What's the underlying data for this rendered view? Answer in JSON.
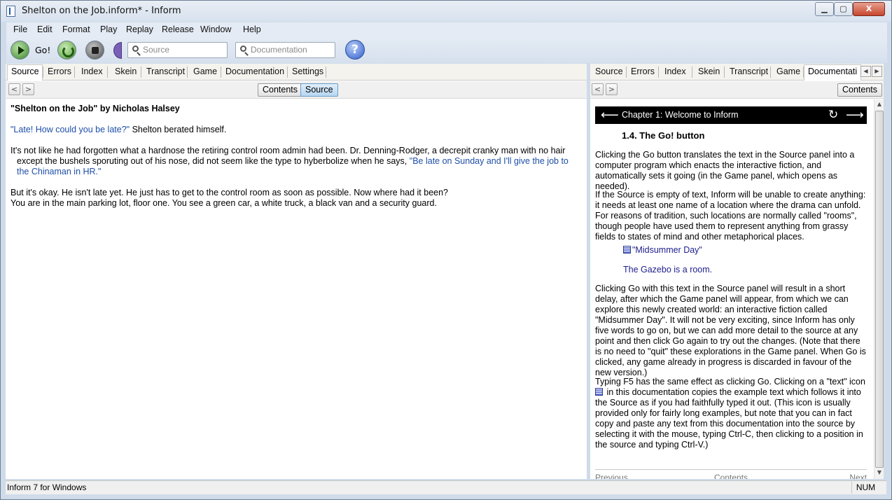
{
  "window": {
    "title": "Shelton on the Job.inform* - Inform",
    "min_label": "▁",
    "max_label": "▢",
    "close_label": "X"
  },
  "menu": {
    "items": [
      "File",
      "Edit",
      "Format",
      "Play",
      "Replay",
      "Release",
      "Window",
      "Help"
    ]
  },
  "toolbar": {
    "go_label": "Go!",
    "source_search_placeholder": "Source",
    "doc_search_placeholder": "Documentation",
    "help_label": "?"
  },
  "left_panel": {
    "tabs": [
      "Source",
      "Errors",
      "Index",
      "Skein",
      "Transcript",
      "Game",
      "Documentation",
      "Settings"
    ],
    "active_tab": "Source",
    "nav_back": "<",
    "nav_forward": ">",
    "view_contents": "Contents",
    "view_source": "Source",
    "source": {
      "title": "\"Shelton on the Job\" by Nicholas Halsey",
      "p1_quote": "\"Late! How could you be late?\"",
      "p1_rest": " Shelton berated himself.",
      "p2_text": "It's not like he had forgotten what a hardnose the retiring control room admin had been. Dr. Denning-Rodger, a decrepit cranky man with no hair except the bushels sporuting out of his nose, did not seem like the type to hyberbolize when he says, ",
      "p2_quote": "\"Be late on Sunday and I'll give the job to the Chinaman in HR.\"",
      "p3_line1": "But it's okay. He isn't late yet. He just has to get to the control room as soon as possible. Now where had it been?",
      "p3_line2": "You are in the main parking lot, floor one. You see a green car, a white truck, a black van and a security guard."
    }
  },
  "right_panel": {
    "tabs": [
      "Source",
      "Errors",
      "Index",
      "Skein",
      "Transcript",
      "Game",
      "Documentati"
    ],
    "active_tab": "Documentati",
    "nav_back": "<",
    "nav_forward": ">",
    "contents_label": "Contents",
    "doc": {
      "chapter": "Chapter 1: Welcome to Inform",
      "section": "1.4. The Go! button",
      "p1": "Clicking the Go button translates the text in the Source panel into a computer program which enacts the interactive fiction, and automatically sets it going (in the Game panel, which opens as needed).",
      "p2": "If the Source is empty of text, Inform will be unable to create anything: it needs at least one name of a location where the drama can unfold. For reasons of tradition, such locations are normally called \"rooms\", though people have used them to represent anything from grassy fields to states of mind and other metaphorical places.",
      "example_line1": "\"Midsummer Day\"",
      "example_line2": "The Gazebo is a room.",
      "p3": "Clicking Go with this text in the Source panel will result in a short delay, after which the Game panel will appear, from which we can explore this newly created world: an interactive fiction called \"Midsummer Day\". It will not be very exciting, since Inform has only five words to go on, but we can add more detail to the source at any point and then click Go again to try out the changes. (Note that there is no need to \"quit\" these explorations in the Game panel. When Go is clicked, any game already in progress is discarded in favour of the new version.)",
      "p4_a": "Typing F5 has the same effect as clicking Go. Clicking on a \"text\" icon ",
      "p4_b": " in this documentation copies the example text which follows it into the Source as if you had faithfully typed it out. (This icon is usually provided only for fairly long examples, but note that you can in fact copy and paste any text from this documentation into the source by selecting it with the mouse, typing Ctrl-C, then clicking to a position in the source and typing Ctrl-V.)",
      "footer_prev": "Previous",
      "footer_contents": "Contents",
      "footer_next": "Next"
    }
  },
  "status": {
    "text": "Inform 7 for Windows",
    "num": "NUM"
  },
  "icons": {
    "go": "play-icon",
    "replay": "replay-icon",
    "stop": "stop-icon",
    "help": "help-icon",
    "search": "search-icon",
    "example": "text-example-icon"
  },
  "colors": {
    "chrome": "#cfdbe9",
    "quote_blue": "#1e4fa8",
    "chapter_bar": "#000000",
    "example_text": "#1d1d8c"
  }
}
